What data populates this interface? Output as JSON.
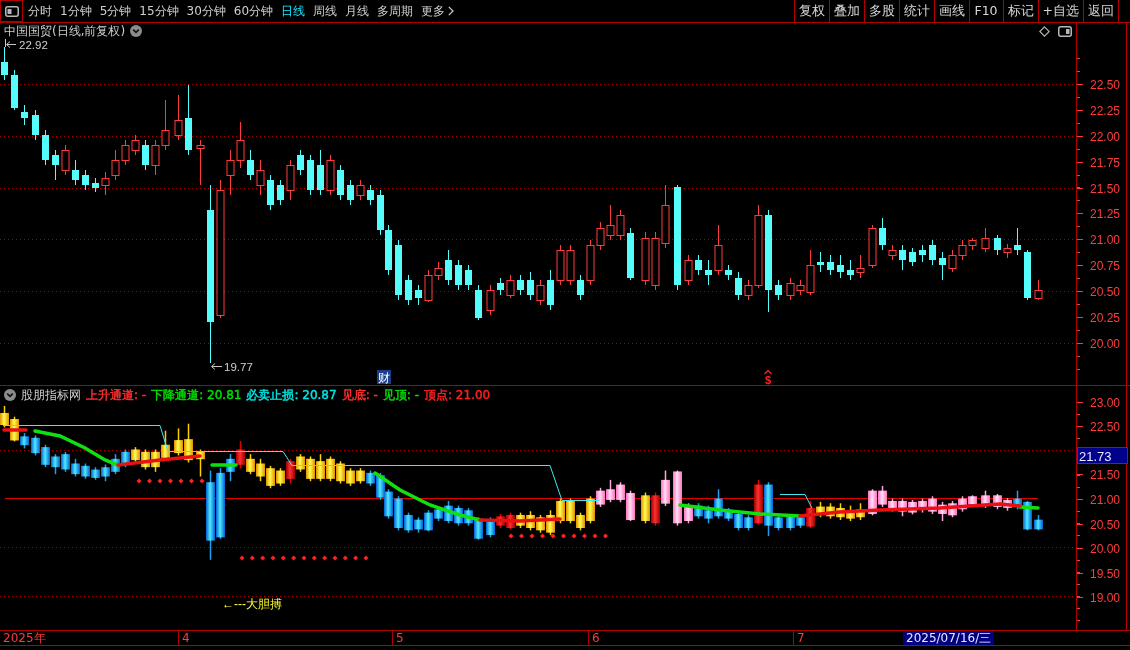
{
  "toolbar": {
    "period_tabs": [
      {
        "label": "分时",
        "kind": "period",
        "selected": false
      },
      {
        "label": "1分钟",
        "kind": "period",
        "selected": false
      },
      {
        "label": "5分钟",
        "kind": "period",
        "selected": false
      },
      {
        "label": "15分钟",
        "kind": "period",
        "selected": false
      },
      {
        "label": "30分钟",
        "kind": "period",
        "selected": false
      },
      {
        "label": "60分钟",
        "kind": "period",
        "selected": false
      },
      {
        "label": "日线",
        "kind": "period",
        "selected": true
      },
      {
        "label": "周线",
        "kind": "period",
        "selected": false
      },
      {
        "label": "月线",
        "kind": "period",
        "selected": false
      },
      {
        "label": "多周期",
        "kind": "period",
        "selected": false
      },
      {
        "label": "更多",
        "kind": "menu",
        "selected": false
      }
    ],
    "actions": [
      "复权",
      "叠加",
      "多股",
      "统计",
      "画线",
      "F10",
      "标记",
      "+自选",
      "返回"
    ]
  },
  "main_chart": {
    "title": "中国国贸(日线,前复权)",
    "y_axis": [
      "22.50",
      "22.25",
      "22.00",
      "21.75",
      "21.50",
      "21.25",
      "21.00",
      "20.75",
      "20.50",
      "20.25",
      "20.00"
    ],
    "high_label": "22.92",
    "low_label": "19.77",
    "event_markers": [
      {
        "kind": "finance",
        "text": "财"
      },
      {
        "kind": "dividend",
        "text": "$"
      }
    ]
  },
  "indicator_panel": {
    "name": "股朋指标网",
    "readouts": [
      {
        "text": "上升通道: -",
        "color": "#ff3030"
      },
      {
        "text": "下降通道: 20.81",
        "color": "#00e000"
      },
      {
        "text": "必卖止损: 20.87",
        "color": "#00e5e5"
      },
      {
        "text": "见底: -",
        "color": "#ff3030"
      },
      {
        "text": "见顶: -",
        "color": "#00e000"
      },
      {
        "text": "顶点: 21.00",
        "color": "#ff2020"
      }
    ],
    "y_axis": [
      "23.00",
      "22.50",
      "21.50",
      "21.00",
      "20.50",
      "20.00",
      "19.50",
      "19.00"
    ],
    "current_value": "21.73",
    "annotation": "←---大胆搏"
  },
  "time_axis": {
    "labels": [
      "2025年",
      "4",
      "5",
      "6",
      "7"
    ],
    "cursor_date": "2025/07/16/三"
  }
}
